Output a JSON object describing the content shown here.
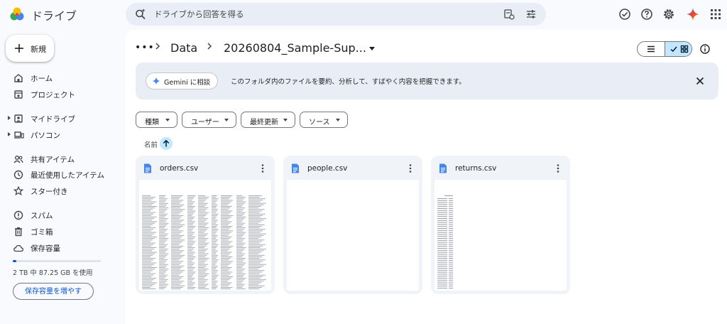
{
  "app": {
    "title": "ドライブ"
  },
  "search": {
    "placeholder": "ドライブから回答を得る"
  },
  "sidebar": {
    "new_label": "新規",
    "items": [
      {
        "label": "ホーム",
        "icon": "home-icon"
      },
      {
        "label": "プロジェクト",
        "icon": "project-icon"
      },
      {
        "label": "マイドライブ",
        "icon": "my-drive-icon"
      },
      {
        "label": "パソコン",
        "icon": "computer-icon"
      },
      {
        "label": "共有アイテム",
        "icon": "shared-icon"
      },
      {
        "label": "最近使用したアイテム",
        "icon": "clock-icon"
      },
      {
        "label": "スター付き",
        "icon": "star-icon"
      },
      {
        "label": "スパム",
        "icon": "spam-icon"
      },
      {
        "label": "ゴミ箱",
        "icon": "trash-icon"
      },
      {
        "label": "保存容量",
        "icon": "cloud-icon"
      }
    ],
    "storage_used_fraction": 0.04,
    "storage_text": "2 TB 中 87.25 GB を使用",
    "storage_button": "保存容量を増やす"
  },
  "breadcrumb": {
    "ellipsis": "•••",
    "parent": "Data",
    "current": "20260804_Sample-Sup..."
  },
  "banner": {
    "chip_label": "Gemini に相談",
    "text": "このフォルダ内のファイルを要約、分析して、すばやく内容を把握できます。"
  },
  "filters": [
    {
      "label": "種類"
    },
    {
      "label": "ユーザー"
    },
    {
      "label": "最終更新"
    },
    {
      "label": "ソース"
    }
  ],
  "sort": {
    "label": "名前"
  },
  "files": [
    {
      "name": "orders.csv"
    },
    {
      "name": "people.csv"
    },
    {
      "name": "returns.csv"
    }
  ],
  "colors": {
    "accent": "#0b57d0",
    "selected": "#c2e7ff",
    "doc_blue": "#4285f4"
  }
}
